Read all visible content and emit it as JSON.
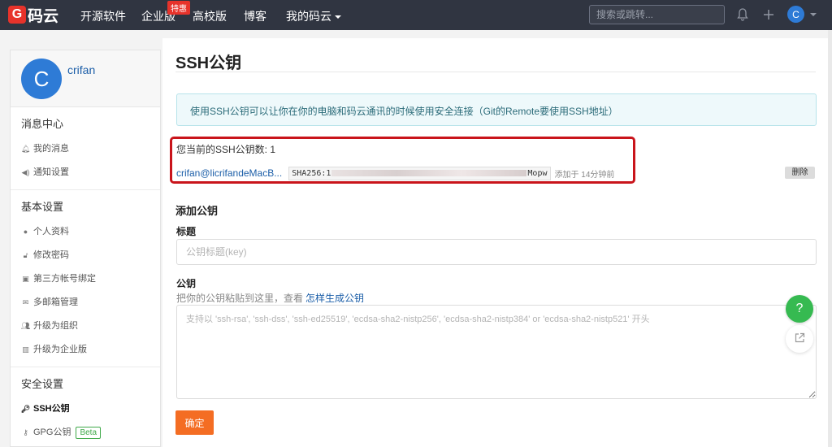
{
  "nav": {
    "logo_text": "码云",
    "items": [
      "开源软件",
      "企业版",
      "高校版",
      "博客",
      "我的码云"
    ],
    "badge": "特惠",
    "search_placeholder": "搜索或跳转...",
    "avatar_letter": "C"
  },
  "sidebar": {
    "avatar_letter": "C",
    "username": "crifan",
    "sections": [
      {
        "title": "消息中心",
        "items": [
          "我的消息",
          "通知设置"
        ]
      },
      {
        "title": "基本设置",
        "items": [
          "个人资料",
          "修改密码",
          "第三方帐号绑定",
          "多邮箱管理",
          "升级为组织",
          "升级为企业版"
        ]
      },
      {
        "title": "安全设置",
        "items": [
          "SSH公钥",
          "GPG公钥"
        ]
      }
    ],
    "beta_label": "Beta"
  },
  "main": {
    "title": "SSH公钥",
    "info": "使用SSH公钥可以让你在你的电脑和码云通讯的时候使用安全连接（Git的Remote要使用SSH地址）",
    "key_count": "您当前的SSH公钥数: 1",
    "key": {
      "name": "crifan@licrifandeMacB...",
      "fingerprint_prefix": "SHA256:1",
      "fingerprint_suffix": "Mopw",
      "added": "添加于 14分钟前"
    },
    "delete_label": "删除",
    "add_title": "添加公钥",
    "title_label": "标题",
    "title_placeholder": "公钥标题(key)",
    "key_label": "公钥",
    "key_hint": "把你的公钥粘贴到这里，查看",
    "key_hint_link": "怎样生成公钥",
    "key_placeholder": "支持以 'ssh-rsa', 'ssh-dss', 'ssh-ed25519', 'ecdsa-sha2-nistp256', 'ecdsa-sha2-nistp384' or 'ecdsa-sha2-nistp521' 开头",
    "submit_label": "确定"
  },
  "floating": {
    "help": "?"
  },
  "colors": {
    "accent": "#f46d23",
    "brand": "#e7332b",
    "link": "#1b5ea8",
    "help": "#36ba51"
  }
}
